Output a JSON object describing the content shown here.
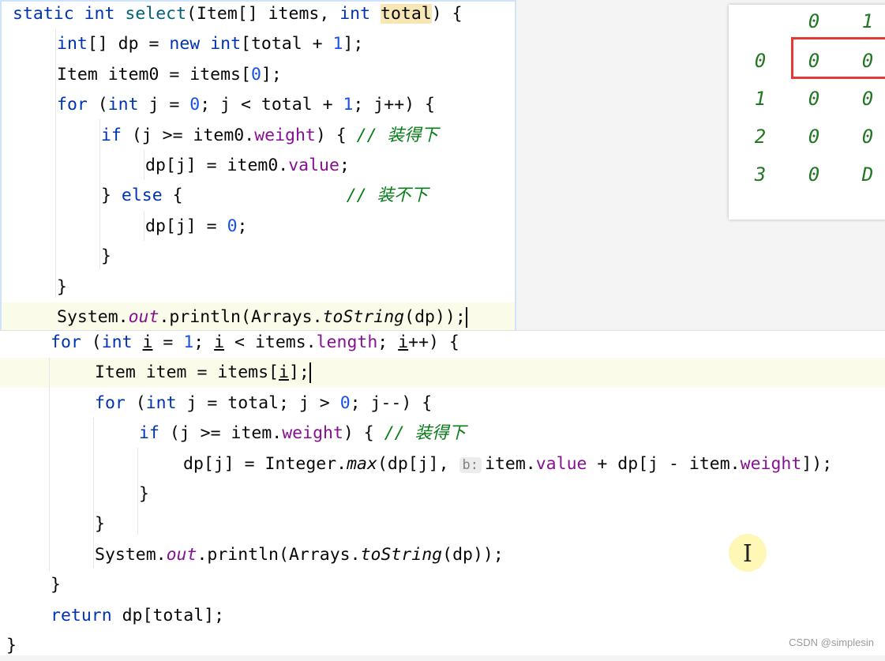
{
  "top_code": {
    "lines": [
      {
        "indent": 0,
        "parts": [
          [
            "kw",
            "static "
          ],
          [
            "kw",
            "int "
          ],
          [
            "fn",
            "select"
          ],
          [
            "",
            "(Item[] items, "
          ],
          [
            "kw",
            "int "
          ],
          [
            "hl",
            "total"
          ],
          [
            "",
            ") {"
          ]
        ]
      },
      {
        "indent": 1,
        "parts": [
          [
            "kw",
            "int"
          ],
          [
            "",
            "[] dp = "
          ],
          [
            "kw",
            "new "
          ],
          [
            "kw",
            "int"
          ],
          [
            "",
            "[total + "
          ],
          [
            "num",
            "1"
          ],
          [
            "",
            "];"
          ]
        ]
      },
      {
        "indent": 1,
        "parts": [
          [
            "",
            "Item item0 = items["
          ],
          [
            "num",
            "0"
          ],
          [
            "",
            "];"
          ]
        ]
      },
      {
        "indent": 1,
        "parts": [
          [
            "kw",
            "for "
          ],
          [
            "",
            "("
          ],
          [
            "kw",
            "int "
          ],
          [
            "",
            "j = "
          ],
          [
            "num",
            "0"
          ],
          [
            "",
            "; j < total + "
          ],
          [
            "num",
            "1"
          ],
          [
            "",
            "; j++) {"
          ]
        ]
      },
      {
        "indent": 2,
        "parts": [
          [
            "kw",
            "if "
          ],
          [
            "",
            "(j >= item0."
          ],
          [
            "fld",
            "weight"
          ],
          [
            "",
            ") { "
          ],
          [
            "cmg",
            "// 装得下"
          ]
        ]
      },
      {
        "indent": 3,
        "parts": [
          [
            "",
            "dp[j] = item0."
          ],
          [
            "fld",
            "value"
          ],
          [
            "",
            ";"
          ]
        ]
      },
      {
        "indent": 2,
        "parts": [
          [
            "",
            "} "
          ],
          [
            "kw",
            "else "
          ],
          [
            "",
            "{                "
          ],
          [
            "cmg",
            "// 装不下"
          ]
        ]
      },
      {
        "indent": 3,
        "parts": [
          [
            "",
            "dp[j] = "
          ],
          [
            "num",
            "0"
          ],
          [
            "",
            ";"
          ]
        ]
      },
      {
        "indent": 2,
        "parts": [
          [
            "",
            "}"
          ]
        ]
      },
      {
        "indent": 1,
        "parts": [
          [
            "",
            "}"
          ]
        ]
      },
      {
        "indent": 1,
        "parts": [
          [
            "",
            "System."
          ],
          [
            "st",
            "out"
          ],
          [
            "",
            ".println(Arrays."
          ],
          [
            "ital",
            "toString"
          ],
          [
            "",
            "(dp));"
          ],
          [
            "caret",
            ""
          ]
        ]
      }
    ]
  },
  "bottom_code": {
    "lines": [
      {
        "indent": 1,
        "parts": [
          [
            "kw",
            "for "
          ],
          [
            "",
            "("
          ],
          [
            "kw",
            "int "
          ],
          [
            "ul",
            "i"
          ],
          [
            "",
            " = "
          ],
          [
            "num",
            "1"
          ],
          [
            "",
            "; "
          ],
          [
            "ul",
            "i"
          ],
          [
            "",
            " < items."
          ],
          [
            "fld",
            "length"
          ],
          [
            "",
            "; "
          ],
          [
            "ul",
            "i"
          ],
          [
            "",
            "++) {"
          ]
        ]
      },
      {
        "indent": 2,
        "parts": [
          [
            "",
            "Item item = items["
          ],
          [
            "ul",
            "i"
          ],
          [
            "",
            "];"
          ],
          [
            "caret",
            ""
          ]
        ]
      },
      {
        "indent": 2,
        "parts": [
          [
            "kw",
            "for "
          ],
          [
            "",
            "("
          ],
          [
            "kw",
            "int "
          ],
          [
            "",
            "j = total; j > "
          ],
          [
            "num",
            "0"
          ],
          [
            "",
            "; j--) {"
          ]
        ]
      },
      {
        "indent": 3,
        "parts": [
          [
            "kw",
            "if "
          ],
          [
            "",
            "(j >= item."
          ],
          [
            "fld",
            "weight"
          ],
          [
            "",
            ") { "
          ],
          [
            "cmg",
            "// 装得下"
          ]
        ]
      },
      {
        "indent": 4,
        "parts": [
          [
            "",
            "dp[j] = Integer."
          ],
          [
            "ital",
            "max"
          ],
          [
            "",
            "(dp[j], "
          ],
          [
            "hint",
            "b:"
          ],
          [
            "",
            "item."
          ],
          [
            "fld",
            "value"
          ],
          [
            "",
            " + dp[j - item."
          ],
          [
            "fld",
            "weight"
          ],
          [
            "",
            "]);"
          ]
        ]
      },
      {
        "indent": 3,
        "parts": [
          [
            "",
            "}"
          ]
        ]
      },
      {
        "indent": 2,
        "parts": [
          [
            "",
            "}"
          ]
        ]
      },
      {
        "indent": 2,
        "parts": [
          [
            "",
            "System."
          ],
          [
            "st",
            "out"
          ],
          [
            "",
            ".println(Arrays."
          ],
          [
            "ital",
            "toString"
          ],
          [
            "",
            "(dp));"
          ]
        ]
      },
      {
        "indent": 1,
        "parts": [
          [
            "",
            "}"
          ]
        ]
      },
      {
        "indent": 1,
        "parts": [
          [
            "kw",
            "return "
          ],
          [
            "",
            "dp[total];"
          ]
        ]
      },
      {
        "indent": 0,
        "parts": [
          [
            "",
            "}"
          ]
        ]
      }
    ]
  },
  "dp_table": {
    "col_headers": [
      "0",
      "1"
    ],
    "rows": [
      {
        "label": "0",
        "cells": [
          "0",
          "0"
        ]
      },
      {
        "label": "1",
        "cells": [
          "0",
          "0"
        ]
      },
      {
        "label": "2",
        "cells": [
          "0",
          "0"
        ]
      },
      {
        "label": "3",
        "cells": [
          "0",
          "D"
        ]
      }
    ]
  },
  "watermark": "CSDN @simplesin",
  "colors": {
    "highlight_word": "#f7e7b4",
    "redbox": "#e53935",
    "comment_green": "#067d17"
  }
}
